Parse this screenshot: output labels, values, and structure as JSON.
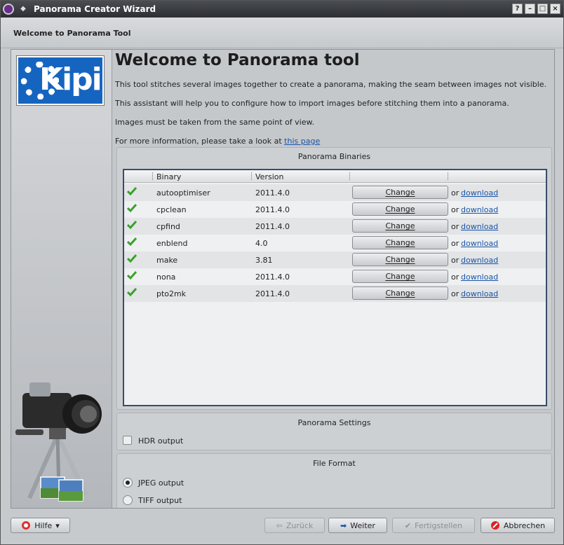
{
  "window": {
    "title": "Panorama Creator Wizard",
    "buttons": [
      "?",
      "–",
      "□",
      "×"
    ]
  },
  "header": {
    "label": "Welcome to Panorama Tool"
  },
  "logo": {
    "text": "Kipi"
  },
  "main": {
    "title": "Welcome to Panorama tool",
    "para1": "This tool stitches several images together to create a panorama, making the seam between images not visible.",
    "para2": "This assistant will help you to configure how to import images before stitching them into a panorama.",
    "para3": "Images must be taken from the same point of view.",
    "para4_prefix": "For more information, please take a look at ",
    "para4_link": "this page"
  },
  "binaries": {
    "title": "Panorama Binaries",
    "columns": [
      "Binary",
      "Version"
    ],
    "rows": [
      {
        "name": "autooptimiser",
        "version": "2011.4.0",
        "button": "Change",
        "or": "or",
        "link": "download"
      },
      {
        "name": "cpclean",
        "version": "2011.4.0",
        "button": "Change",
        "or": "or",
        "link": "download"
      },
      {
        "name": "cpfind",
        "version": "2011.4.0",
        "button": "Change",
        "or": "or",
        "link": "download"
      },
      {
        "name": "enblend",
        "version": "4.0",
        "button": "Change",
        "or": "or",
        "link": "download"
      },
      {
        "name": "make",
        "version": "3.81",
        "button": "Change",
        "or": "or",
        "link": "download"
      },
      {
        "name": "nona",
        "version": "2011.4.0",
        "button": "Change",
        "or": "or",
        "link": "download"
      },
      {
        "name": "pto2mk",
        "version": "2011.4.0",
        "button": "Change",
        "or": "or",
        "link": "download"
      }
    ]
  },
  "settings": {
    "title": "Panorama Settings",
    "hdr_label": "HDR output",
    "hdr_checked": false
  },
  "format": {
    "title": "File Format",
    "jpeg_label": "JPEG output",
    "tiff_label": "TIFF output",
    "selected": "JPEG output"
  },
  "footer": {
    "help": "Hilfe",
    "back": "Zurück",
    "next": "Weiter",
    "finish": "Fertigstellen",
    "cancel": "Abbrechen"
  },
  "colors": {
    "link": "#1a55a8",
    "title_bar": "#2d2f33",
    "logo_bg": "#1565c0",
    "check": "#3aa02a"
  }
}
